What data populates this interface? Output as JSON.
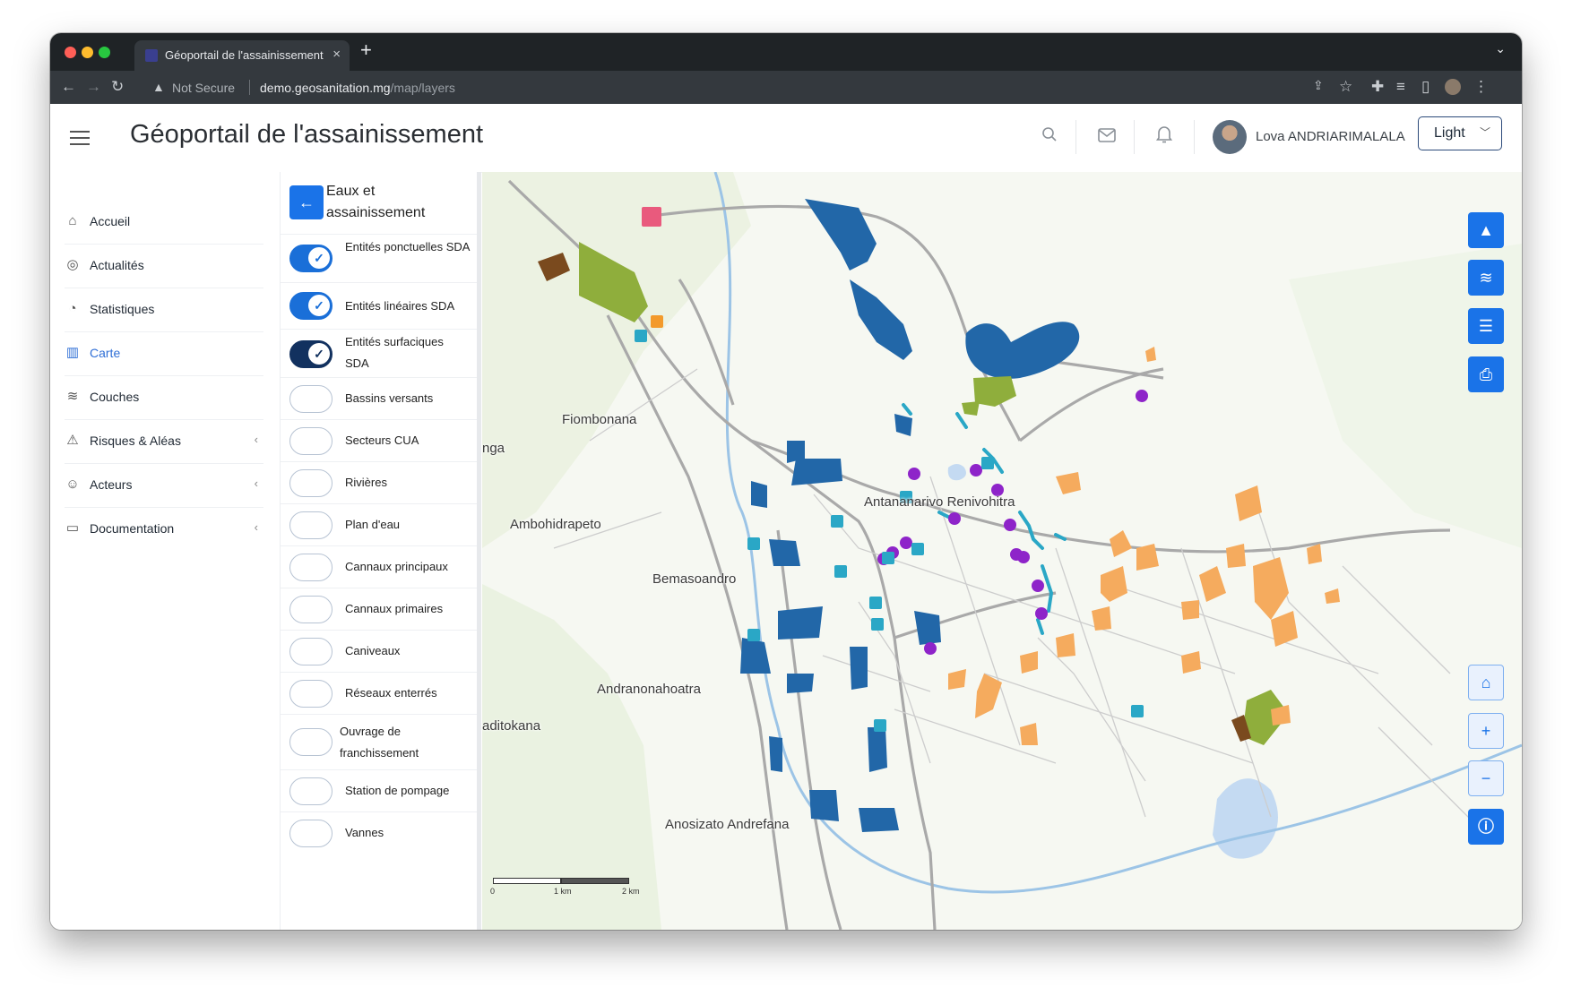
{
  "browser": {
    "tab_title": "Géoportail de l'assainissement",
    "tab_close": "×",
    "new_tab": "+",
    "not_secure": "Not Secure",
    "url_host": "demo.geosanitation.mg",
    "url_path": "/map/layers"
  },
  "header": {
    "title": "Géoportail de l'assainissement",
    "user_name": "Lova ANDRIARIMALALA",
    "theme_select": "Light"
  },
  "sidebar": {
    "items": [
      {
        "label": "Accueil",
        "icon": "home-icon",
        "active": false,
        "expandable": false
      },
      {
        "label": "Actualités",
        "icon": "globe-icon",
        "active": false,
        "expandable": false
      },
      {
        "label": "Statistiques",
        "icon": "pie-chart-icon",
        "active": false,
        "expandable": false
      },
      {
        "label": "Carte",
        "icon": "map-icon",
        "active": true,
        "expandable": false
      },
      {
        "label": "Couches",
        "icon": "layers-icon",
        "active": false,
        "expandable": false
      },
      {
        "label": "Risques & Aléas",
        "icon": "warning-icon",
        "active": false,
        "expandable": true
      },
      {
        "label": "Acteurs",
        "icon": "users-icon",
        "active": false,
        "expandable": true
      },
      {
        "label": "Documentation",
        "icon": "book-icon",
        "active": false,
        "expandable": true
      }
    ]
  },
  "layer_panel": {
    "title": "Eaux et assainissement",
    "layers": [
      {
        "label": "Entités ponctuelles SDA",
        "enabled": true
      },
      {
        "label": "Entités linéaires SDA",
        "enabled": true
      },
      {
        "label": "Entités surfaciques SDA",
        "enabled": true
      },
      {
        "label": "Bassins versants",
        "enabled": false
      },
      {
        "label": "Secteurs CUA",
        "enabled": false
      },
      {
        "label": "Rivières",
        "enabled": false
      },
      {
        "label": "Plan d'eau",
        "enabled": false
      },
      {
        "label": "Cannaux principaux",
        "enabled": false
      },
      {
        "label": "Cannaux primaires",
        "enabled": false
      },
      {
        "label": "Caniveaux",
        "enabled": false
      },
      {
        "label": "Réseaux enterrés",
        "enabled": false
      },
      {
        "label": "Ouvrage de franchissement",
        "enabled": false
      },
      {
        "label": "Station de pompage",
        "enabled": false
      },
      {
        "label": "Vannes",
        "enabled": false
      }
    ]
  },
  "map": {
    "places": [
      "Fiombonana",
      "nga",
      "Antananarivo Renivohitra",
      "Ambohidrapeto",
      "Bemasoandro",
      "Andranonahoatra",
      "aditokana",
      "Anosizato Andrefana"
    ],
    "scale": {
      "labels": [
        "0",
        "1 km",
        "2 km"
      ]
    },
    "colors": {
      "water_blue": "#2267a8",
      "green_area": "#8fae3c",
      "brown_area": "#7a4a1e",
      "orange_area": "#f5ab5e",
      "cyan_line": "#2aa7c6",
      "purple_point": "#8e24c9",
      "accent": "#1a73e8"
    }
  }
}
